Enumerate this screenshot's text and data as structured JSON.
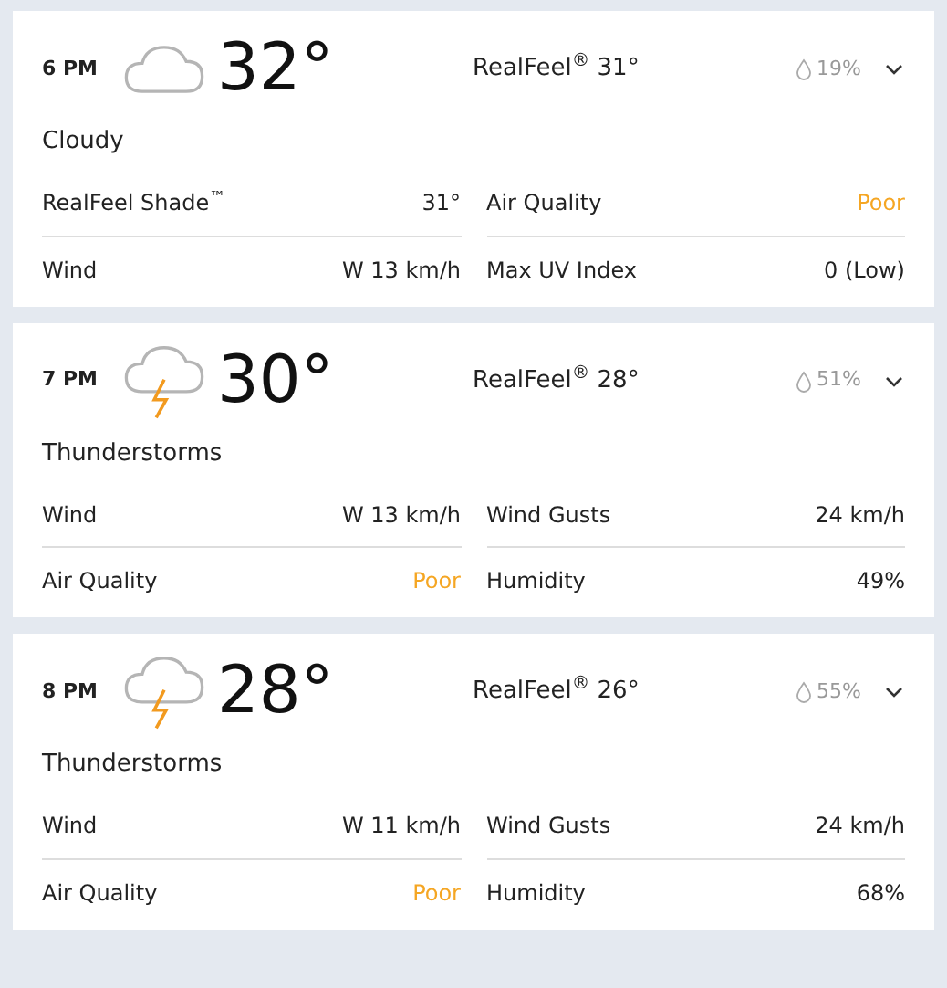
{
  "hours": [
    {
      "time": "6 PM",
      "kind": "cloudy",
      "temp": "32°",
      "realfeel": "RealFeel$^{®}$ 31°",
      "precip": "19%",
      "phrase": "Cloudy",
      "stats": [
        {
          "label": "RealFeel Shade$^{™}$",
          "value": "31°"
        },
        {
          "label": "Air Quality",
          "value": "Poor",
          "color": "#f5a623"
        },
        {
          "label": "Wind",
          "value": "W 13 km/h"
        },
        {
          "label": "Max UV Index",
          "value": "0 (Low)"
        }
      ]
    },
    {
      "time": "7 PM",
      "kind": "thunderstorm",
      "temp": "30°",
      "realfeel": "RealFeel$^{®}$ 28°",
      "precip": "51%",
      "phrase": "Thunderstorms",
      "stats": [
        {
          "label": "Wind",
          "value": "W 13 km/h"
        },
        {
          "label": "Wind Gusts",
          "value": "24 km/h"
        },
        {
          "label": "Air Quality",
          "value": "Poor",
          "color": "#f5a623"
        },
        {
          "label": "Humidity",
          "value": "49%"
        }
      ]
    },
    {
      "time": "8 PM",
      "kind": "thunderstorm",
      "temp": "28°",
      "realfeel": "RealFeel$^{®}$ 26°",
      "precip": "55%",
      "phrase": "Thunderstorms",
      "stats": [
        {
          "label": "Wind",
          "value": "W 11 km/h"
        },
        {
          "label": "Wind Gusts",
          "value": "24 km/h"
        },
        {
          "label": "Air Quality",
          "value": "Poor",
          "color": "#f5a623"
        },
        {
          "label": "Humidity",
          "value": "68%"
        }
      ]
    }
  ]
}
